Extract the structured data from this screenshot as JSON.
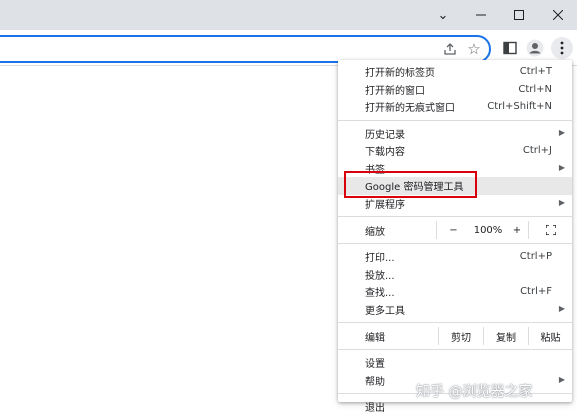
{
  "window": {
    "minimize_icon": "chevron-down-icon",
    "min_glyph": "—",
    "max_glyph": "☐",
    "close_glyph": "✕",
    "dropdown_glyph": "⌄"
  },
  "toolbar": {
    "share_glyph": "⇪",
    "star_glyph": "☆",
    "kebab_glyph": "⋮"
  },
  "menu": {
    "new_tab": {
      "label": "打开新的标签页",
      "shortcut": "Ctrl+T"
    },
    "new_window": {
      "label": "打开新的窗口",
      "shortcut": "Ctrl+N"
    },
    "new_incognito": {
      "label": "打开新的无痕式窗口",
      "shortcut": "Ctrl+Shift+N"
    },
    "history": {
      "label": "历史记录"
    },
    "downloads": {
      "label": "下载内容",
      "shortcut": "Ctrl+J"
    },
    "bookmarks": {
      "label": "书签"
    },
    "password_manager": {
      "label": "Google 密码管理工具"
    },
    "extensions": {
      "label": "扩展程序"
    },
    "zoom": {
      "label": "缩放",
      "minus": "−",
      "value": "100%",
      "plus": "+",
      "fullscreen_glyph": "⛶"
    },
    "print": {
      "label": "打印...",
      "shortcut": "Ctrl+P"
    },
    "cast": {
      "label": "投放..."
    },
    "find": {
      "label": "查找...",
      "shortcut": "Ctrl+F"
    },
    "more_tools": {
      "label": "更多工具"
    },
    "edit": {
      "label": "编辑",
      "cut": "剪切",
      "copy": "复制",
      "paste": "粘贴"
    },
    "settings": {
      "label": "设置"
    },
    "help": {
      "label": "帮助"
    },
    "exit": {
      "label": "退出"
    },
    "arrow_glyph": "▶"
  },
  "watermark": "知乎 @浏览器之家"
}
